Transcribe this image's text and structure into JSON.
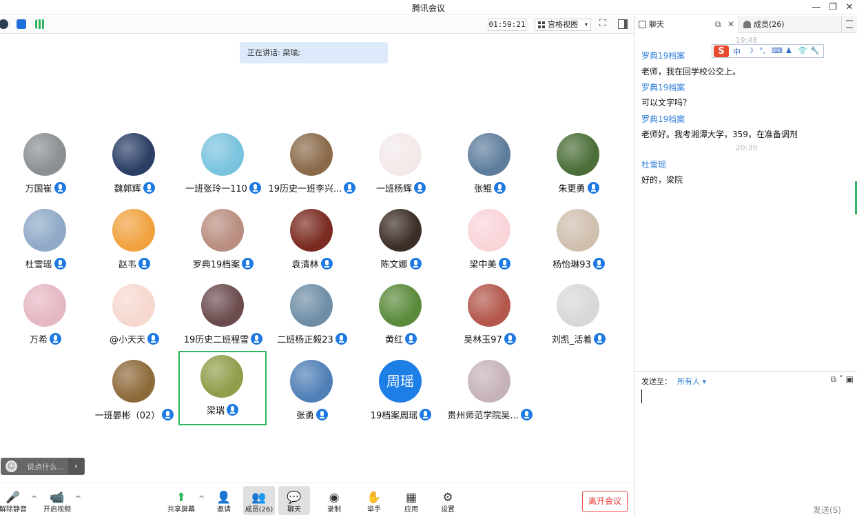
{
  "window": {
    "title": "腾讯会议",
    "minimize": "—",
    "restore": "❐",
    "close": "✕"
  },
  "toolbar": {
    "timer": "01:59:21",
    "view_label": "宫格视图",
    "view_caret": "▾",
    "fullscreen": "⛶"
  },
  "speaking": {
    "text": "正在讲话: 梁瑞;"
  },
  "participants": [
    {
      "name": "万国崔",
      "color": "#8a8f91"
    },
    {
      "name": "魏郭辉",
      "color": "#2b3f66"
    },
    {
      "name": "一班张玲一110",
      "color": "#7ac3de"
    },
    {
      "name": "19历史一班李兴...",
      "color": "#8a6a4a"
    },
    {
      "name": "一班杨辉",
      "color": "#f3e9e9"
    },
    {
      "name": "张鲲",
      "color": "#5e7d9c"
    },
    {
      "name": "朱更勇",
      "color": "#4b6e38"
    },
    {
      "name": "杜雪瑶",
      "color": "#8fa9c6"
    },
    {
      "name": "赵韦",
      "color": "#f0a23f"
    },
    {
      "name": "罗典19档案",
      "color": "#b98d7f"
    },
    {
      "name": "袁清林",
      "color": "#7a2a20"
    },
    {
      "name": "陈文娜",
      "color": "#3c2d26"
    },
    {
      "name": "梁中美",
      "color": "#f9d4d9"
    },
    {
      "name": "杨怡琳93",
      "color": "#cfbfae"
    },
    {
      "name": "万希",
      "color": "#e5b7c3"
    },
    {
      "name": "@小天天",
      "color": "#f6d8cf"
    },
    {
      "name": "19历史二班程雪",
      "color": "#6b4b4e"
    },
    {
      "name": "二班杨正毅23",
      "color": "#6f8ea6"
    },
    {
      "name": "黄红",
      "color": "#5b8a3b"
    },
    {
      "name": "吴林玉97",
      "color": "#b3574b"
    },
    {
      "name": "刘凯_活着",
      "color": "#d8d8d8"
    },
    {
      "name": "一班晏彬（02）",
      "color": "#8d6a3a"
    },
    {
      "name": "梁瑞",
      "color": "#8f9e4a"
    },
    {
      "name": "张勇",
      "color": "#4f7fb6"
    },
    {
      "name": "19档案周瑶",
      "text": "周瑶"
    },
    {
      "name": "贵州师范学院吴...",
      "color": "#c6b3b8"
    }
  ],
  "chat_input": {
    "placeholder": "说点什么...",
    "smile": "☺",
    "collapse": "‹"
  },
  "bottombar": {
    "unmute": {
      "label": "解除静音",
      "icon": "🎤"
    },
    "video": {
      "label": "开启视频",
      "icon": "📹"
    },
    "share": {
      "label": "共享屏幕",
      "icon": "⬆"
    },
    "invite": {
      "label": "邀请",
      "icon": "👤"
    },
    "members": {
      "label": "成员(26)",
      "icon": "👥"
    },
    "chat": {
      "label": "聊天",
      "icon": "💬"
    },
    "record": {
      "label": "录制",
      "icon": "◉"
    },
    "hand": {
      "label": "举手",
      "icon": "✋"
    },
    "apps": {
      "label": "应用",
      "icon": "▦"
    },
    "settings": {
      "label": "设置",
      "icon": "⚙"
    },
    "leave": "离开会议",
    "caret": "^"
  },
  "panel": {
    "tab_chat": "聊天",
    "tab_members": "成员(26)",
    "messages": [
      {
        "type": "time",
        "text": "19:48"
      },
      {
        "type": "sender",
        "text": "罗典19档案"
      },
      {
        "type": "text",
        "text": "老师，我在回学校公交上。"
      },
      {
        "type": "sender",
        "text": "罗典19档案"
      },
      {
        "type": "text",
        "text": "可以文字吗？"
      },
      {
        "type": "sender",
        "text": "罗典19档案"
      },
      {
        "type": "text",
        "text": "老师好。我考湘潭大学，359，在准备调剂"
      },
      {
        "type": "time",
        "text": "20:39"
      },
      {
        "type": "sender",
        "text": "杜雪瑶"
      },
      {
        "type": "text",
        "text": "好的，梁院"
      }
    ],
    "ime": {
      "logo": "S",
      "mode": "中",
      "moon": "☽",
      "dot": "°,",
      "keyboard": "⌨",
      "user": "♟",
      "shirt": "👕",
      "wrench": "🔧"
    },
    "send_to_label": "发送至：",
    "send_to_value": "所有人 ▾",
    "send_button": "发送(S)"
  }
}
